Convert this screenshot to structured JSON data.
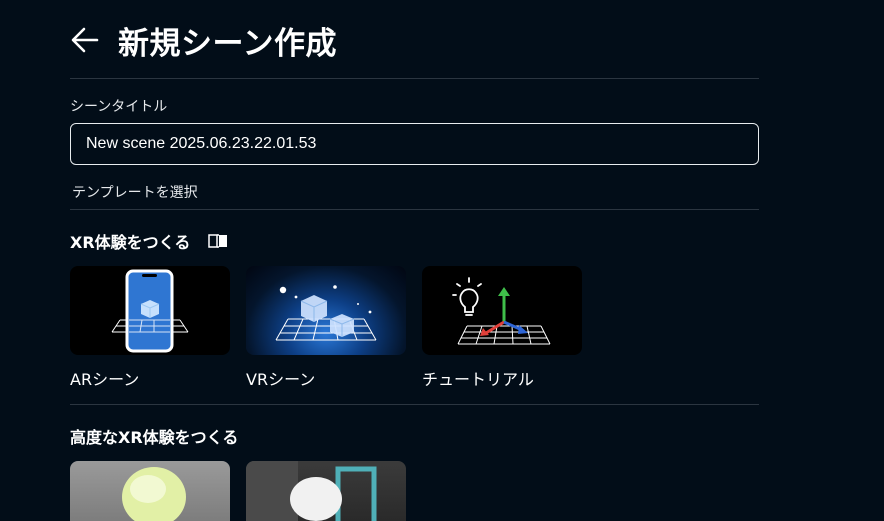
{
  "header": {
    "title": "新規シーン作成",
    "back_icon": "arrow-left-icon"
  },
  "form": {
    "title_label": "シーンタイトル",
    "title_value": "New scene 2025.06.23.22.01.53",
    "template_label": "テンプレートを選択"
  },
  "sections": {
    "basic": {
      "heading": "XR体験をつくる",
      "guide_icon": "book-icon",
      "cards": [
        {
          "label": "ARシーン",
          "icon": "phone-cube-grid"
        },
        {
          "label": "VRシーン",
          "icon": "cubes-grid"
        },
        {
          "label": "チュートリアル",
          "icon": "bulb-axes-grid"
        }
      ]
    },
    "advanced": {
      "heading": "高度なXR体験をつくる",
      "cards": [
        {
          "label": "",
          "icon": "green-sphere"
        },
        {
          "label": "",
          "icon": "white-sphere-frame"
        }
      ]
    }
  },
  "colors": {
    "background": "#020d18",
    "divider": "#2b3540",
    "text": "#ffffff",
    "axis_red": "#e0403a",
    "axis_green": "#3fbf4a",
    "axis_blue": "#2f66d6"
  }
}
